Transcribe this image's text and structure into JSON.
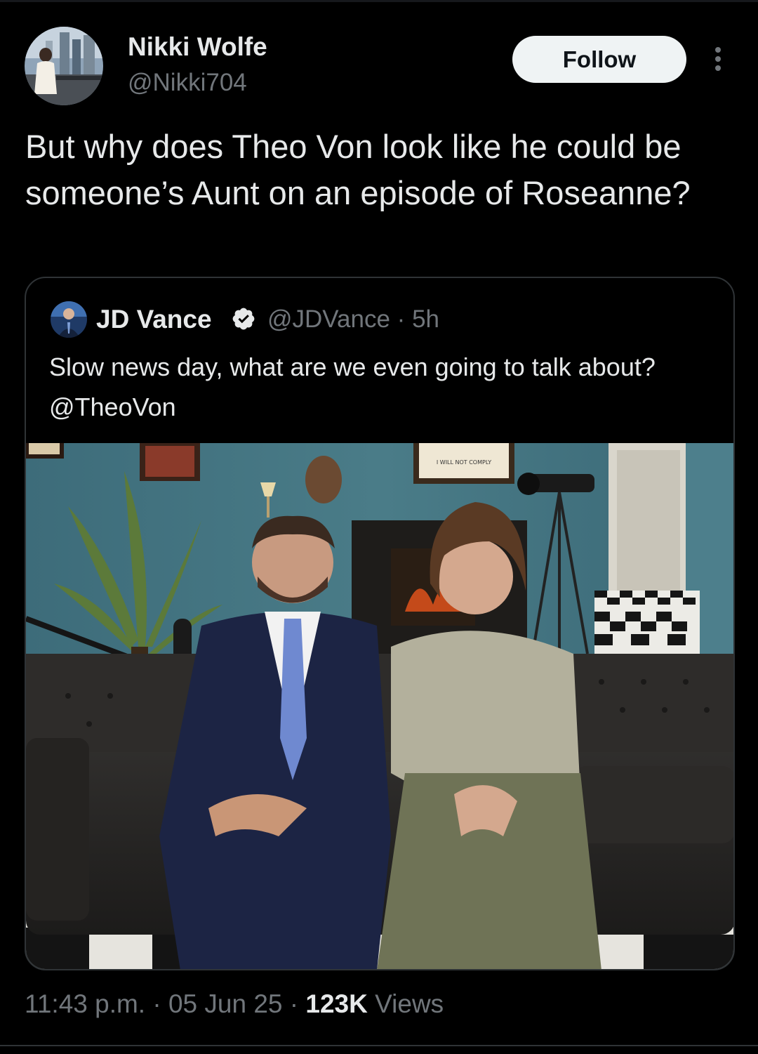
{
  "tweet": {
    "author_name": "Nikki Wolfe",
    "author_handle": "@Nikki704",
    "follow_label": "Follow",
    "text": "But why does Theo Von look like he could be someone’s Aunt on an episode of Roseanne?",
    "time": "11:43 p.m.",
    "sep1": " · ",
    "date": "05 Jun 25",
    "sep2": " · ",
    "views_count": "123K",
    "views_label": " Views"
  },
  "quoted": {
    "author_name": "JD Vance",
    "author_handle": "@JDVance",
    "meta_sep": " · ",
    "age": "5h",
    "text": "Slow news day, what are we even going to talk about? @TheoVon",
    "photo_sign_text": "I WILL NOT COMPLY"
  },
  "colors": {
    "background": "#000000",
    "text_primary": "#e7e9ea",
    "text_secondary": "#71767b",
    "verified": "#1d9bf0",
    "border": "#2f3336"
  },
  "icons": {
    "more": "more-vertical-icon",
    "verified": "verified-badge-icon"
  }
}
